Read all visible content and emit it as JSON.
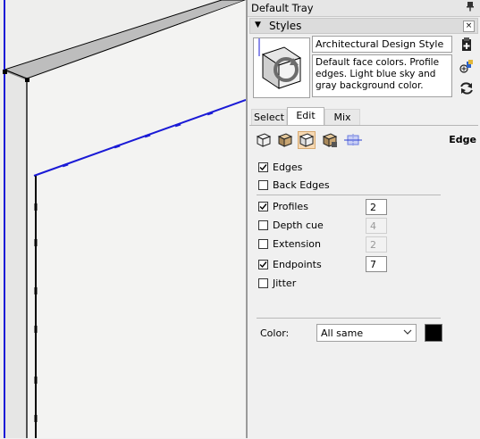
{
  "tray": {
    "title": "Default Tray",
    "pin_glyph": "📌"
  },
  "styles": {
    "header": "Styles",
    "collapse_glyph": "▼",
    "close_glyph": "×",
    "name": "Architectural Design Style",
    "description": "Default face colors. Profile edges. Light blue sky and gray background color."
  },
  "side_icons": [
    "create-style-icon",
    "update-style-icon",
    "refresh-icon"
  ],
  "tabs": {
    "select": "Select",
    "edit": "Edit",
    "mix": "Mix",
    "active": "Edit"
  },
  "edit_icons": [
    "edge-settings-icon",
    "face-settings-icon",
    "background-settings-icon",
    "watermark-settings-icon",
    "modeling-settings-icon"
  ],
  "section_title": "Edge",
  "settings": {
    "edges": {
      "label": "Edges",
      "checked": true
    },
    "back_edges": {
      "label": "Back Edges",
      "checked": false
    },
    "profiles": {
      "label": "Profiles",
      "checked": true,
      "value": "2"
    },
    "depth_cue": {
      "label": "Depth cue",
      "checked": false,
      "value": "4"
    },
    "extension": {
      "label": "Extension",
      "checked": false,
      "value": "2"
    },
    "endpoints": {
      "label": "Endpoints",
      "checked": true,
      "value": "7"
    },
    "jitter": {
      "label": "Jitter",
      "checked": false
    }
  },
  "color": {
    "label": "Color:",
    "selected": "All same",
    "swatch": "#000000"
  },
  "colors": {
    "edge_blue": "#1a1ad6",
    "wall_face": "#f2f2f1",
    "panel_bg": "#f0f0f0",
    "selected_icon_bg": "#f6d9b4"
  }
}
